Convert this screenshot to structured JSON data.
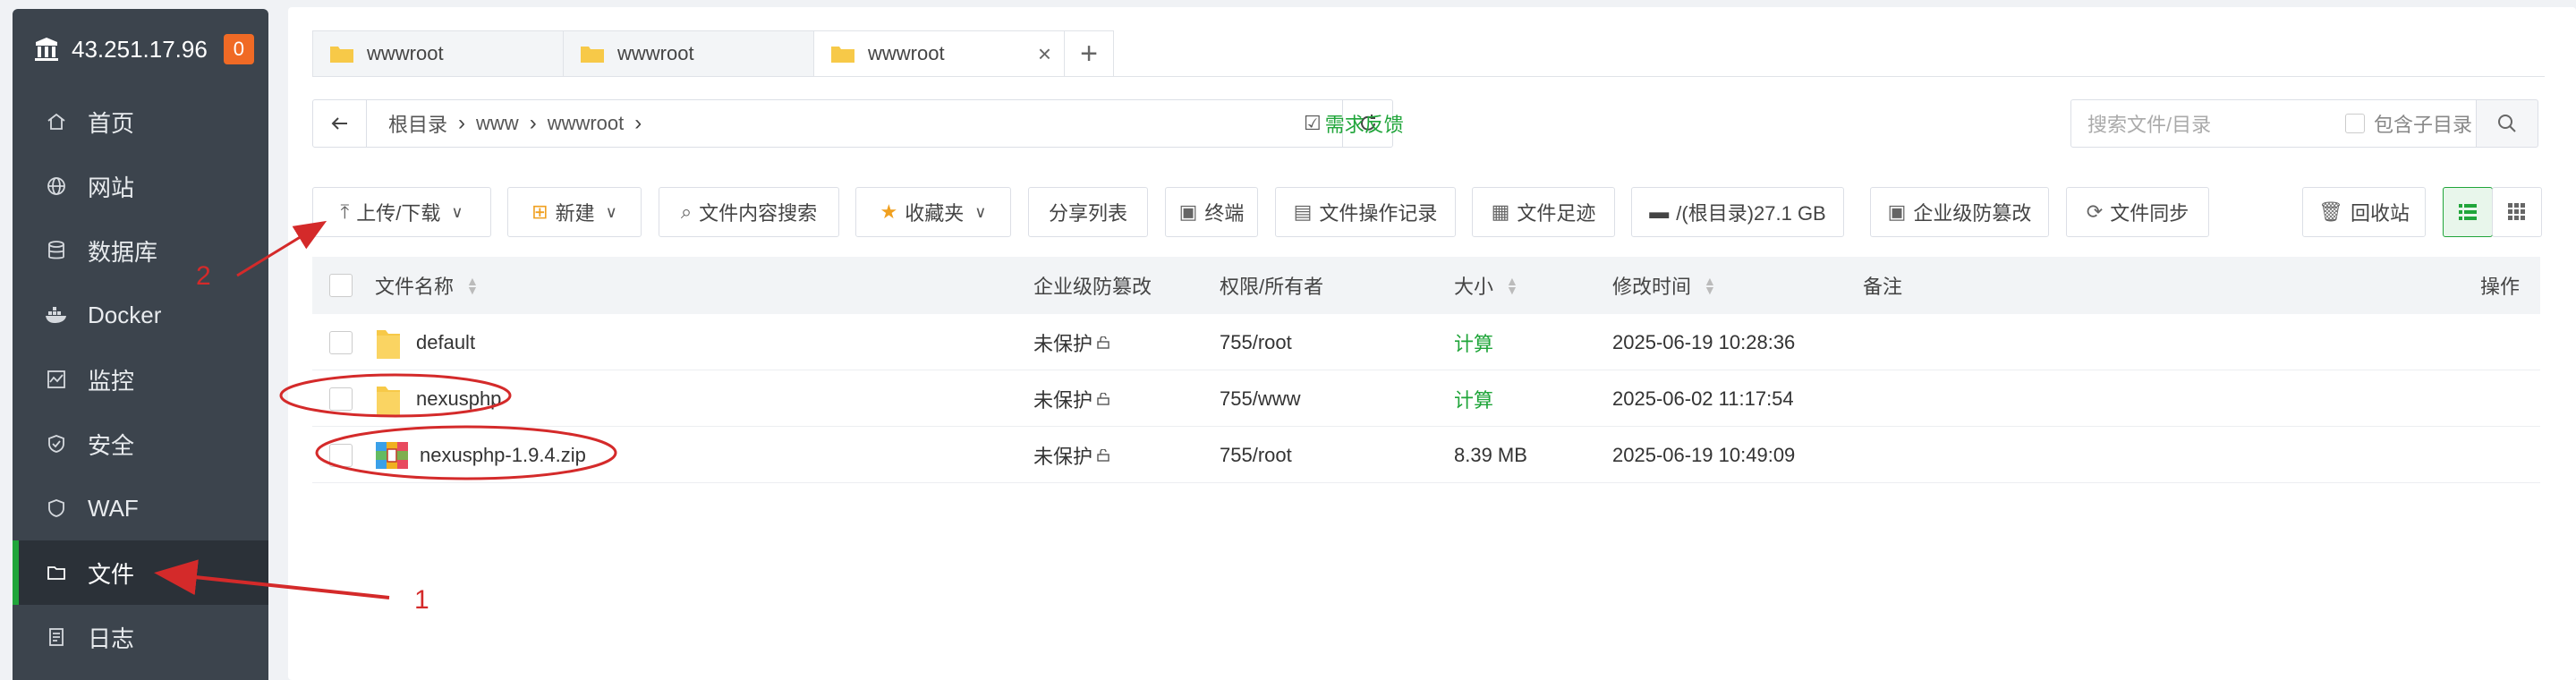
{
  "sidebar": {
    "server_ip": "43.251.17.96",
    "badge_count": "0",
    "items": [
      {
        "label": "首页",
        "icon": "home-icon"
      },
      {
        "label": "网站",
        "icon": "globe-icon"
      },
      {
        "label": "数据库",
        "icon": "database-icon"
      },
      {
        "label": "Docker",
        "icon": "docker-icon"
      },
      {
        "label": "监控",
        "icon": "monitor-icon"
      },
      {
        "label": "安全",
        "icon": "shield-icon"
      },
      {
        "label": "WAF",
        "icon": "waf-shield-icon"
      },
      {
        "label": "文件",
        "icon": "folder-icon",
        "active": true
      },
      {
        "label": "日志",
        "icon": "log-icon"
      }
    ]
  },
  "tabs": [
    {
      "label": "wwwroot"
    },
    {
      "label": "wwwroot"
    },
    {
      "label": "wwwroot",
      "active": true
    }
  ],
  "path": {
    "crumbs": [
      "根目录",
      "www",
      "wwwroot"
    ],
    "feedback": "需求反馈"
  },
  "search": {
    "placeholder": "搜索文件/目录",
    "include_sub": "包含子目录"
  },
  "toolbar": {
    "upload": "上传/下载",
    "new": "新建",
    "content_search": "文件内容搜索",
    "favorites": "收藏夹",
    "share_list": "分享列表",
    "terminal": "终端",
    "op_log": "文件操作记录",
    "footprint": "文件足迹",
    "disk": "/(根目录)27.1 GB",
    "tamper": "企业级防篡改",
    "sync": "文件同步",
    "recycle": "回收站"
  },
  "table": {
    "headers": {
      "name": "文件名称",
      "tamper": "企业级防篡改",
      "perm": "权限/所有者",
      "size": "大小",
      "mtime": "修改时间",
      "note": "备注",
      "ops": "操作"
    },
    "rows": [
      {
        "name": "default",
        "type": "folder",
        "tamper": "未保护",
        "perm": "755/root",
        "size": "计算",
        "mtime": "2025-06-19 10:28:36"
      },
      {
        "name": "nexusphp",
        "type": "folder",
        "tamper": "未保护",
        "perm": "755/www",
        "size": "计算",
        "mtime": "2025-06-02 11:17:54"
      },
      {
        "name": "nexusphp-1.9.4.zip",
        "type": "zip",
        "tamper": "未保护",
        "perm": "755/root",
        "size": "8.39 MB",
        "mtime": "2025-06-19 10:49:09"
      }
    ]
  },
  "annotations": {
    "label_1": "1",
    "label_2": "2"
  },
  "colors": {
    "sidebar_bg": "#3c444d",
    "accent_green": "#20a53a",
    "badge_orange": "#f06a25",
    "annotation_red": "#d42a2a"
  }
}
